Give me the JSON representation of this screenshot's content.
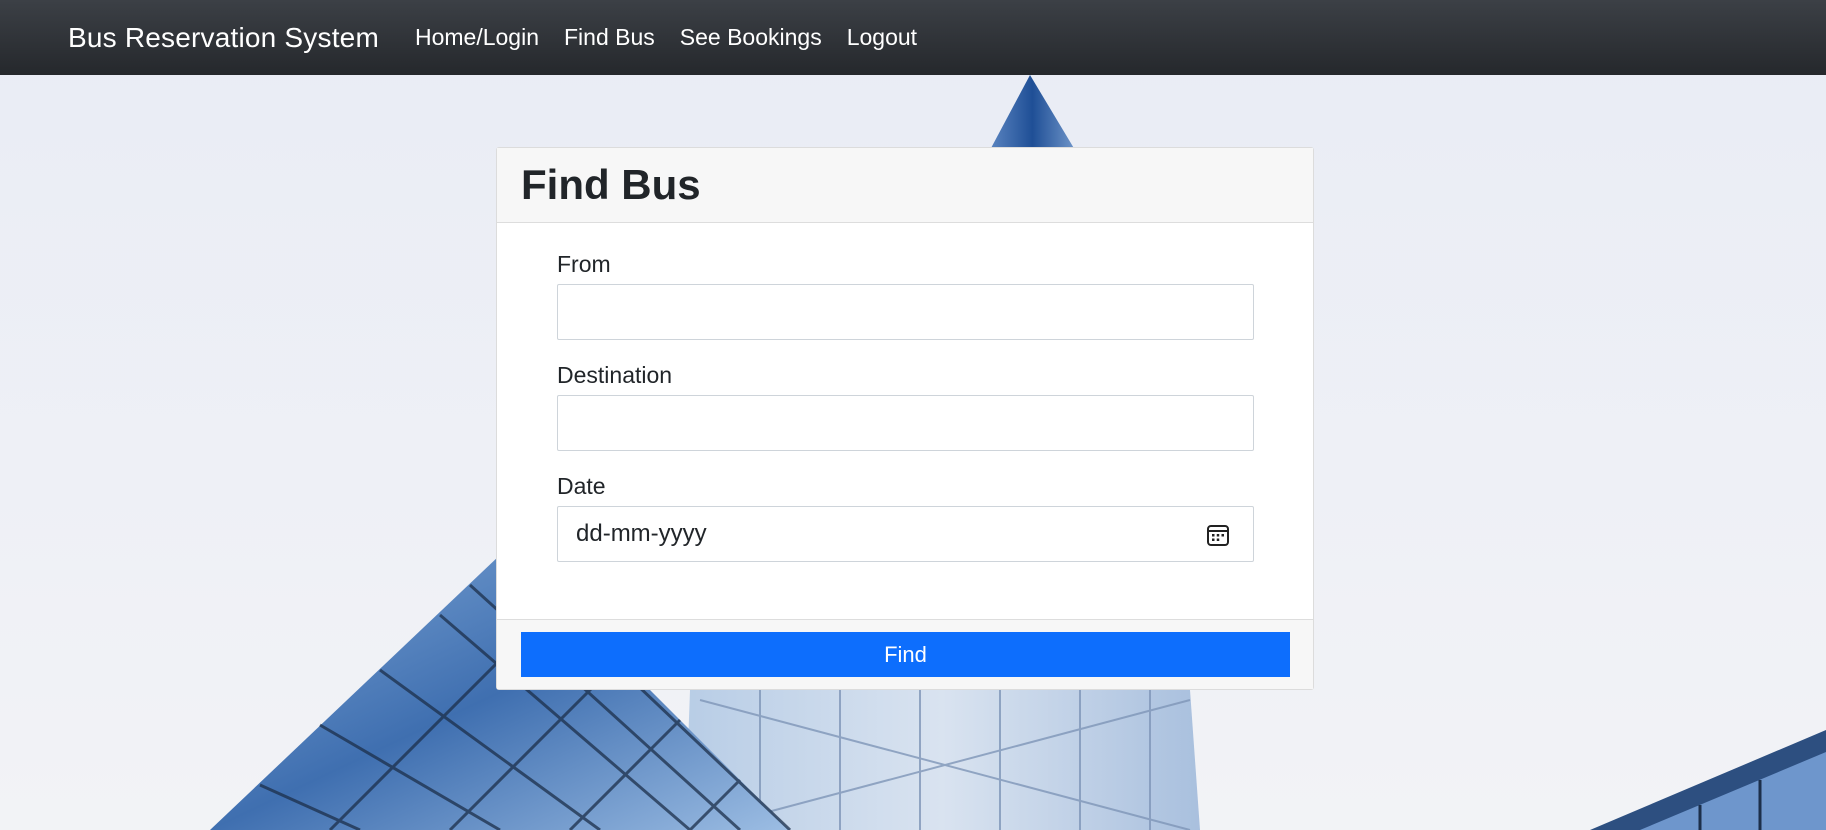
{
  "navbar": {
    "brand": "Bus Reservation System",
    "links": [
      "Home/Login",
      "Find Bus",
      "See Bookings",
      "Logout"
    ]
  },
  "card": {
    "title": "Find Bus",
    "from": {
      "label": "From",
      "value": ""
    },
    "destination": {
      "label": "Destination",
      "value": ""
    },
    "date": {
      "label": "Date",
      "placeholder": "dd-mm-yyyy",
      "icon": "calendar-icon"
    },
    "button_label": "Find"
  },
  "colors": {
    "navbar": "#2f3237",
    "primary": "#0d6efd",
    "card_header": "#f7f7f7"
  }
}
